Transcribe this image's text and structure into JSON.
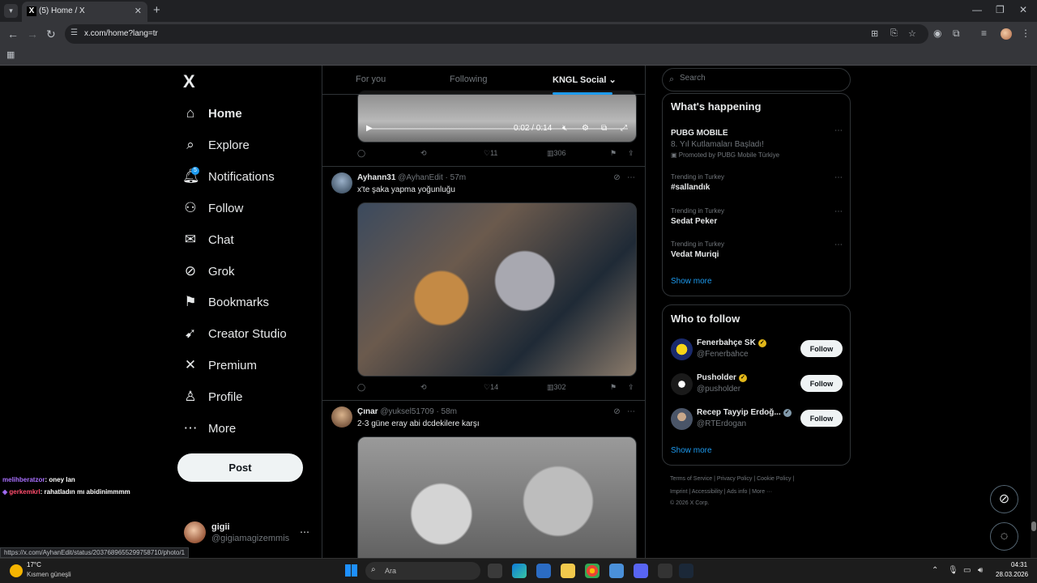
{
  "browser": {
    "tab_title": "(5) Home / X",
    "tab_close": "✕",
    "new_tab": "+",
    "url": "x.com/home?lang=tr",
    "status_url": "https://x.com/AyhanEdit/status/2037689655299758710/photo/1",
    "window_controls": [
      "—",
      "❐",
      "✕"
    ]
  },
  "nav": {
    "logo": "X",
    "items": [
      {
        "icon": "home-icon",
        "glyph": "⌂",
        "label": "Home"
      },
      {
        "icon": "search-icon",
        "glyph": "⌕",
        "label": "Explore"
      },
      {
        "icon": "bell-icon",
        "glyph": "🔔︎",
        "label": "Notifications",
        "badge": "5"
      },
      {
        "icon": "person-add-icon",
        "glyph": "⚇",
        "label": "Follow"
      },
      {
        "icon": "mail-icon",
        "glyph": "✉",
        "label": "Chat"
      },
      {
        "icon": "grok-icon",
        "glyph": "⊘",
        "label": "Grok"
      },
      {
        "icon": "bookmark-icon",
        "glyph": "⚑",
        "label": "Bookmarks"
      },
      {
        "icon": "rocket-icon",
        "glyph": "➹",
        "label": "Creator Studio"
      },
      {
        "icon": "x-icon",
        "glyph": "✕",
        "label": "Premium"
      },
      {
        "icon": "profile-icon",
        "glyph": "♙",
        "label": "Profile"
      },
      {
        "icon": "more-circle-icon",
        "glyph": "⋯",
        "label": "More"
      }
    ],
    "post_label": "Post",
    "user": {
      "name": "gigii",
      "handle": "@gigiamagizemmis",
      "more": "⋯"
    }
  },
  "chat_overlay": [
    {
      "user": "melihberatzor",
      "text": ": oney lan",
      "color": "#a970ff"
    },
    {
      "user": "gerkemkrl",
      "text": ": rahatladın mı abidinimmmm",
      "color": "#ff4d6d"
    }
  ],
  "feed": {
    "tabs": [
      "For you",
      "Following",
      "KNGL Social"
    ],
    "active_tab": "KNGL Social",
    "tweets": [
      {
        "video_time": "0:02 / 0:14",
        "replies": "",
        "retweets": "",
        "likes": "11",
        "views": "306"
      },
      {
        "name": "Ayhann31",
        "handle": "@AyhanEdit",
        "time": "· 57m",
        "text": "x'te şaka yapma yoğunluğu",
        "likes": "14",
        "views": "302"
      },
      {
        "name": "Çınar",
        "handle": "@yuksel51709",
        "time": "· 58m",
        "text": "2-3 güne eray abi dcdekilere karşı"
      }
    ]
  },
  "search": {
    "placeholder": "Search"
  },
  "whats_happening": {
    "title": "What's happening",
    "trends": [
      {
        "category": "",
        "name": "PUBG MOBILE",
        "sub": "8. Yıl Kutlamaları Başladı!",
        "promo": "Promoted by PUBG Mobile Türkiye"
      },
      {
        "category": "Trending in Turkey",
        "name": "#sallandık"
      },
      {
        "category": "Trending in Turkey",
        "name": "Sedat Peker"
      },
      {
        "category": "Trending in Turkey",
        "name": "Vedat Muriqi"
      }
    ],
    "show_more": "Show more"
  },
  "who_to_follow": {
    "title": "Who to follow",
    "accounts": [
      {
        "name": "Fenerbahçe SK",
        "handle": "@Fenerbahce",
        "verified": "gold",
        "avatar_color": "#1a2a6c"
      },
      {
        "name": "Pusholder",
        "handle": "@pusholder",
        "verified": "gold",
        "avatar_color": "#1a1a1a"
      },
      {
        "name": "Recep Tayyip Erdoğ...",
        "handle": "@RTErdogan",
        "verified": "grey",
        "avatar_color": "#4a5568"
      }
    ],
    "follow_label": "Follow",
    "show_more": "Show more"
  },
  "footer": {
    "line1": "Terms of Service  |  Privacy Policy  |  Cookie Policy  |",
    "line2": "Imprint  |  Accessibility  |  Ads info  |  More ···",
    "line3": "© 2026 X Corp."
  },
  "taskbar": {
    "temperature": "17°C",
    "weather": "Kısmen güneşli",
    "search_placeholder": "Ara",
    "time": "04:31",
    "date": "28.03.2026"
  }
}
